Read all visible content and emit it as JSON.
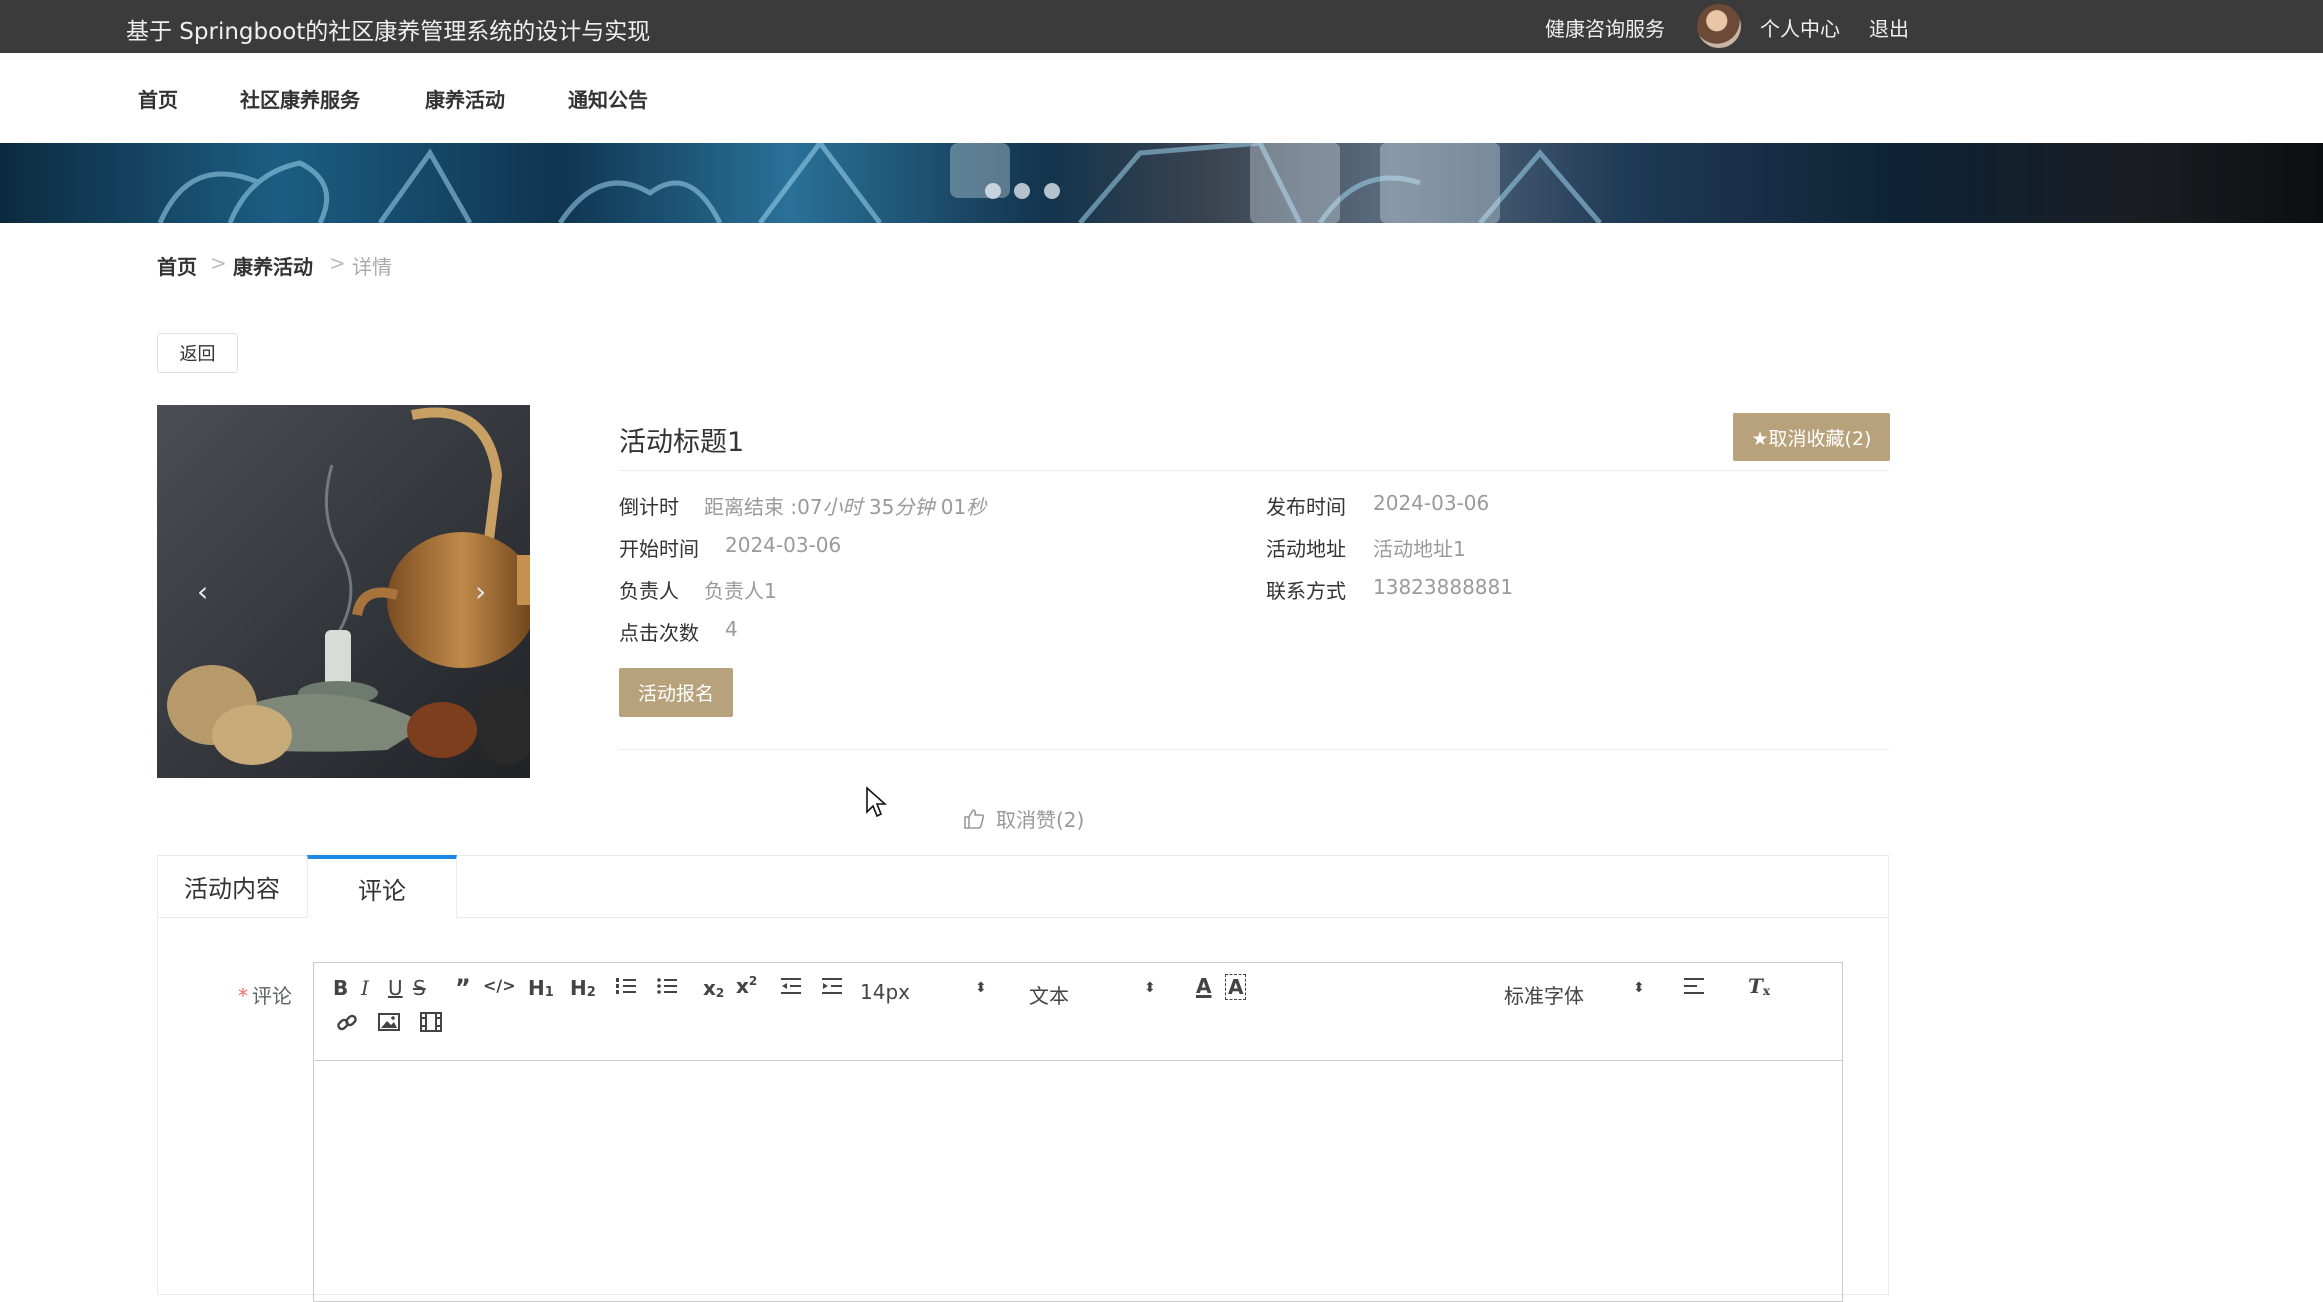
{
  "header": {
    "site_title": "基于 Springboot的社区康养管理系统的设计与实现",
    "links": [
      "健康咨询服务",
      "个人中心",
      "退出"
    ]
  },
  "nav": [
    "首页",
    "社区康养服务",
    "康养活动",
    "通知公告"
  ],
  "banner": {
    "slide_count": 3
  },
  "breadcrumb": [
    "首页",
    "康养活动",
    "详情"
  ],
  "breadcrumb_sep": ">",
  "back_label": "返回",
  "activity": {
    "title": "活动标题1",
    "favorite_label": "★取消收藏(2)",
    "fields": {
      "countdown_label": "倒计时",
      "countdown_prefix": "距离结束 :07",
      "countdown_hours_unit": "小时",
      "countdown_minutes": " 35",
      "countdown_minutes_unit": "分钟",
      "countdown_seconds": " 01",
      "countdown_seconds_unit": "秒",
      "publish_label": "发布时间",
      "publish_value": "2024-03-06",
      "start_label": "开始时间",
      "start_value": "2024-03-06",
      "address_label": "活动地址",
      "address_value": "活动地址1",
      "owner_label": "负责人",
      "owner_value": "负责人1",
      "contact_label": "联系方式",
      "contact_value": "13823888881",
      "clicks_label": "点击次数",
      "clicks_value": "4"
    },
    "signup_label": "活动报名",
    "like_label": "取消赞(2)"
  },
  "tabs": [
    "活动内容",
    "评论"
  ],
  "active_tab": "评论",
  "comment": {
    "label": "评论",
    "font_size": "14px",
    "paragraph": "文本",
    "font_family": "标准字体"
  },
  "colors": {
    "accent": "#b8a27c",
    "tab_active": "#1e88e5",
    "topbar": "#3b3b3b"
  }
}
